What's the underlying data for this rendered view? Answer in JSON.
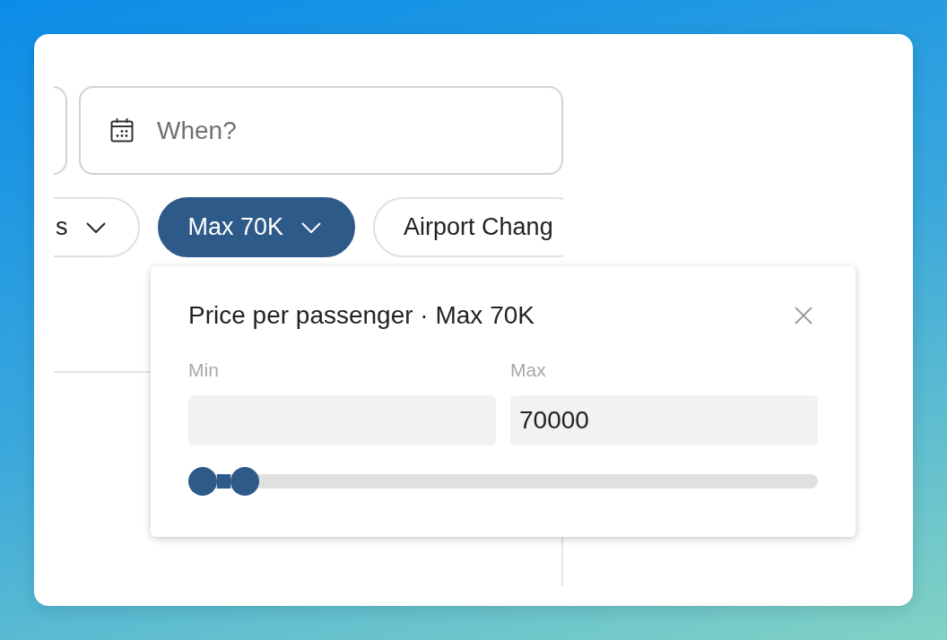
{
  "search_fields": [
    {
      "kind": "cut_off"
    },
    {
      "kind": "date",
      "placeholder": "When?"
    }
  ],
  "filter_chips": [
    {
      "label": "s",
      "selected": false,
      "expandable": true
    },
    {
      "label": "Max 70K",
      "selected": true,
      "expandable": true
    },
    {
      "label": "Airport Chang",
      "selected": false,
      "expandable": false
    }
  ],
  "price_filter": {
    "title": "Price per passenger · Max 70K",
    "fields": [
      {
        "label": "Min"
      },
      {
        "label": "Max",
        "value": "70000"
      }
    ],
    "slider": {
      "thumbs": [
        {
          "level": 0
        },
        {
          "level": 0.07
        }
      ]
    }
  }
}
